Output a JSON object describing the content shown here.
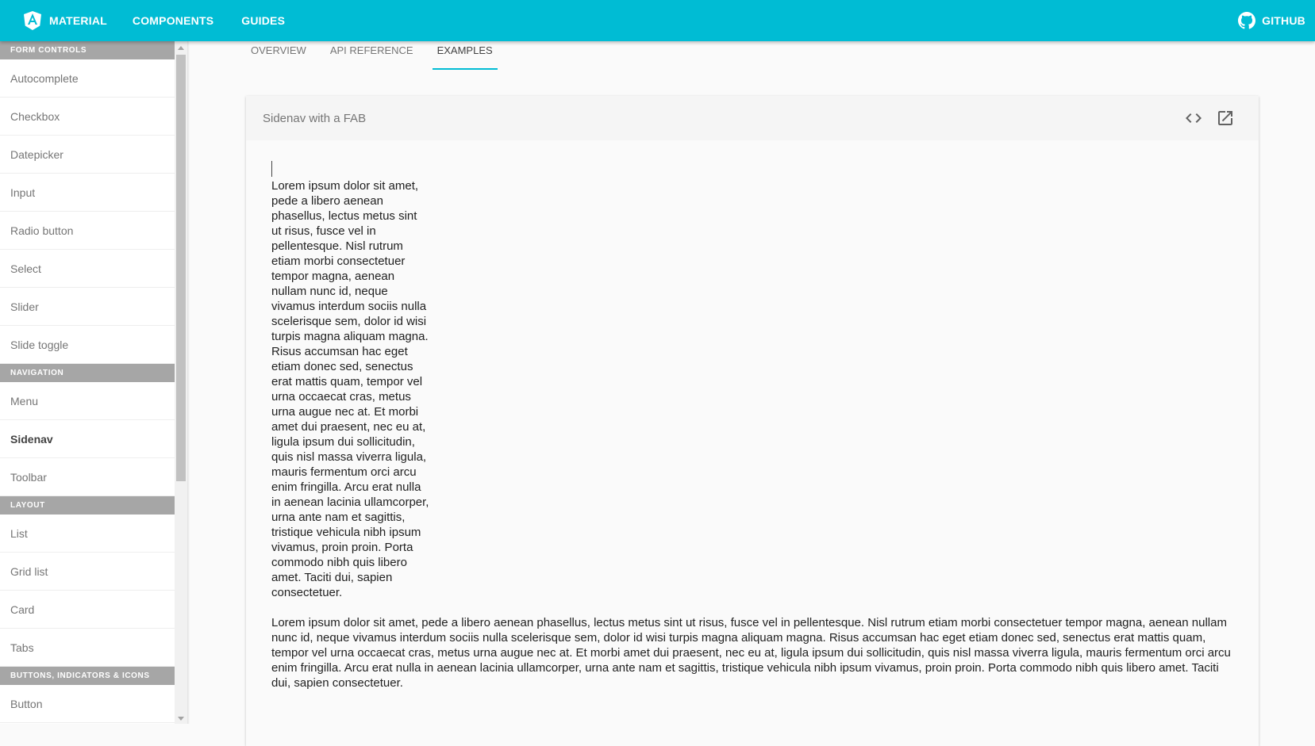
{
  "topbar": {
    "brand_label": "MATERIAL",
    "components_label": "COMPONENTS",
    "guides_label": "GUIDES",
    "github_label": "GITHUB",
    "background": "#00bcd4"
  },
  "sidebar": {
    "sections": [
      {
        "title": "FORM CONTROLS",
        "items": [
          "Autocomplete",
          "Checkbox",
          "Datepicker",
          "Input",
          "Radio button",
          "Select",
          "Slider",
          "Slide toggle"
        ]
      },
      {
        "title": "NAVIGATION",
        "items": [
          "Menu",
          "Sidenav",
          "Toolbar"
        ]
      },
      {
        "title": "LAYOUT",
        "items": [
          "List",
          "Grid list",
          "Card",
          "Tabs"
        ]
      },
      {
        "title": "BUTTONS, INDICATORS & ICONS",
        "items": [
          "Button"
        ]
      }
    ],
    "active_item": "Sidenav"
  },
  "tabs": {
    "overview": "OVERVIEW",
    "api": "API REFERENCE",
    "examples": "EXAMPLES",
    "active": "EXAMPLES"
  },
  "example": {
    "title": "Sidenav with a FAB",
    "code_icon": "code-icon",
    "open_icon": "open-in-new-icon",
    "paragraph_narrow": "Lorem ipsum dolor sit amet, pede a libero aenean phasellus, lectus metus sint ut risus, fusce vel in pellentesque. Nisl rutrum etiam morbi consectetuer tempor magna, aenean nullam nunc id, neque vivamus interdum sociis nulla scelerisque sem, dolor id wisi turpis magna aliquam magna. Risus accumsan hac eget etiam donec sed, senectus erat mattis quam, tempor vel urna occaecat cras, metus urna augue nec at. Et morbi amet dui praesent, nec eu at, ligula ipsum dui sollicitudin, quis nisl massa viverra ligula, mauris fermentum orci arcu enim fringilla. Arcu erat nulla in aenean lacinia ullamcorper, urna ante nam et sagittis, tristique vehicula nibh ipsum vivamus, proin proin. Porta commodo nibh quis libero amet. Taciti dui, sapien consectetuer.",
    "paragraph_wide": "Lorem ipsum dolor sit amet, pede a libero aenean phasellus, lectus metus sint ut risus, fusce vel in pellentesque. Nisl rutrum etiam morbi consectetuer tempor magna, aenean nullam nunc id, neque vivamus interdum sociis nulla scelerisque sem, dolor id wisi turpis magna aliquam magna. Risus accumsan hac eget etiam donec sed, senectus erat mattis quam, tempor vel urna occaecat cras, metus urna augue nec at. Et morbi amet dui praesent, nec eu at, ligula ipsum dui sollicitudin, quis nisl massa viverra ligula, mauris fermentum orci arcu enim fringilla. Arcu erat nulla in aenean lacinia ullamcorper, urna ante nam et sagittis, tristique vehicula nibh ipsum vivamus, proin proin. Porta commodo nibh quis libero amet. Taciti dui, sapien consectetuer."
  }
}
